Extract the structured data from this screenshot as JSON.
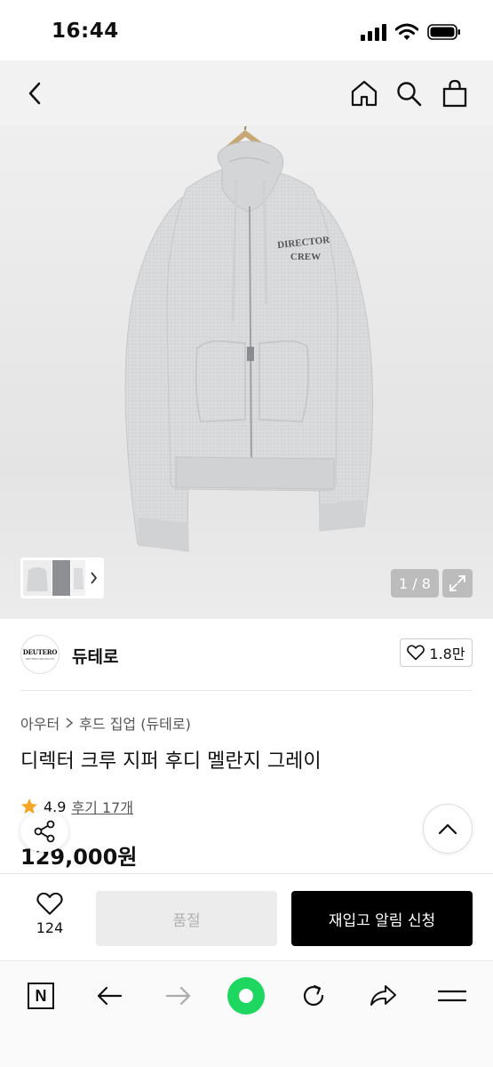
{
  "status": {
    "time": "16:44"
  },
  "pager": {
    "text": "1 / 8"
  },
  "brand": {
    "logo_text": "DEUTERO",
    "logo_subtext": "DEUTERO PRODUCTS",
    "name": "듀테로",
    "likes": "1.8만"
  },
  "breadcrumb": {
    "level1": "아우터",
    "level2": "후드 집업 (듀테로)"
  },
  "product": {
    "title": "디렉터 크루 지퍼 후디 멜란지 그레이",
    "rating": "4.9",
    "review_link": "후기 17개",
    "price": "129,000원"
  },
  "garment": {
    "print_line1": "DIRECTOR",
    "print_line2": "CREW"
  },
  "buy_bar": {
    "wish_count": "124",
    "soldout_label": "품절",
    "restock_label": "재입고 알림 신청"
  },
  "browser_bar": {
    "home_badge": "N"
  },
  "colors": {
    "star": "#f5a623",
    "browser_green": "#1ed760",
    "cta_black": "#000000"
  }
}
